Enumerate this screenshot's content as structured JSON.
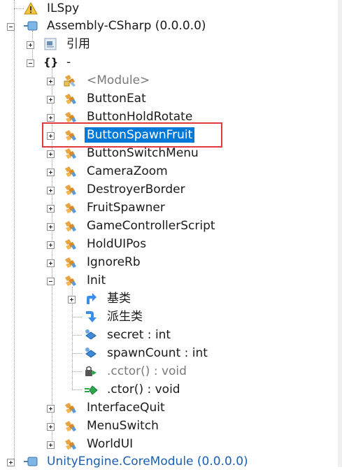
{
  "tree": {
    "ilspy": "ILSpy",
    "assembly": "Assembly-CSharp (0.0.0.0)",
    "references": "引用",
    "namespace": "-",
    "module": "<Module>",
    "classes": {
      "button_eat": "ButtonEat",
      "button_hold_rotate": "ButtonHoldRotate",
      "button_spawn_fruit": "ButtonSpawnFruit",
      "button_switch_menu": "ButtonSwitchMenu",
      "camera_zoom": "CameraZoom",
      "destroyer_border": "DestroyerBorder",
      "fruit_spawner": "FruitSpawner",
      "game_controller_script": "GameControllerScript",
      "hold_ui_pos": "HoldUIPos",
      "ignore_rb": "IgnoreRb",
      "init": "Init",
      "interface_quit": "InterfaceQuit",
      "menu_switch": "MenuSwitch",
      "world_ui": "WorldUI"
    },
    "init_children": {
      "base_types": "基类",
      "derived_types": "派生类",
      "secret": "secret : int",
      "spawn_count": "spawnCount : int",
      "cctor": ".cctor() : void",
      "ctor": ".ctor() : void"
    },
    "unity_core": "UnityEngine.CoreModule (0.0.0.0)"
  },
  "colors": {
    "selection": "#0078d7",
    "highlight_box": "#e0393e",
    "assembly_link": "#1a5fb4"
  }
}
